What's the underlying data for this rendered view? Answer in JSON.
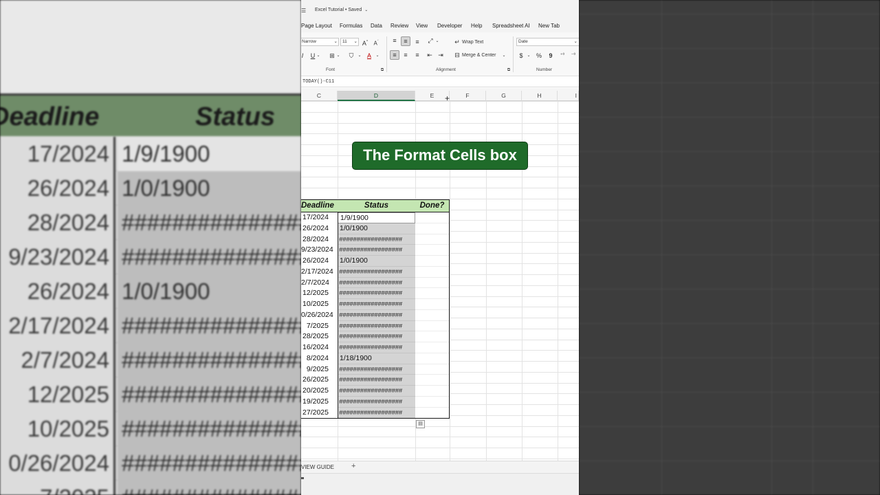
{
  "background_zoom": {
    "header_deadline": "Deadline",
    "header_status": "Status",
    "rows": [
      {
        "deadline": "17/2024",
        "status": "1/9/1900"
      },
      {
        "deadline": "26/2024",
        "status": "1/0/1900"
      },
      {
        "deadline": "28/2024",
        "status": "###################"
      },
      {
        "deadline": "9/23/2024",
        "status": "###################"
      },
      {
        "deadline": "26/2024",
        "status": "1/0/1900"
      },
      {
        "deadline": "2/17/2024",
        "status": "###################"
      },
      {
        "deadline": "2/7/2024",
        "status": "###################"
      },
      {
        "deadline": "12/2025",
        "status": "###################"
      },
      {
        "deadline": "10/2025",
        "status": "###################"
      },
      {
        "deadline": "0/26/2024",
        "status": "###################"
      },
      {
        "deadline": "7/2025",
        "status": "###################"
      }
    ]
  },
  "excel": {
    "title": "Excel Tutorial",
    "saved": "Saved",
    "menu": [
      "Page Layout",
      "Formulas",
      "Data",
      "Review",
      "View",
      "Developer",
      "Help",
      "Spreadsheet AI",
      "New Tab"
    ],
    "ribbon": {
      "font_name": "Narrow",
      "font_size": "11",
      "wrap_text": "Wrap Text",
      "merge_center": "Merge & Center",
      "number_format": "Date",
      "group_font": "Font",
      "group_alignment": "Alignment",
      "group_number": "Number"
    },
    "formula": "TODAY()-C11",
    "columns": [
      "C",
      "D",
      "E",
      "F",
      "G",
      "H",
      "I"
    ],
    "banner": "The Format Cells box",
    "table": {
      "headers": {
        "deadline": "Deadline",
        "status": "Status",
        "done": "Done?"
      },
      "rows": [
        {
          "deadline": "17/2024",
          "status": "1/9/1900",
          "hash": false
        },
        {
          "deadline": "26/2024",
          "status": "1/0/1900",
          "hash": false
        },
        {
          "deadline": "28/2024",
          "status": "##################",
          "hash": true
        },
        {
          "deadline": "9/23/2024",
          "status": "##################",
          "hash": true
        },
        {
          "deadline": "26/2024",
          "status": "1/0/1900",
          "hash": false
        },
        {
          "deadline": "2/17/2024",
          "status": "##################",
          "hash": true
        },
        {
          "deadline": "2/7/2024",
          "status": "##################",
          "hash": true
        },
        {
          "deadline": "12/2025",
          "status": "##################",
          "hash": true
        },
        {
          "deadline": "10/2025",
          "status": "##################",
          "hash": true
        },
        {
          "deadline": "0/26/2024",
          "status": "##################",
          "hash": true
        },
        {
          "deadline": "7/2025",
          "status": "##################",
          "hash": true
        },
        {
          "deadline": "28/2025",
          "status": "##################",
          "hash": true
        },
        {
          "deadline": "16/2024",
          "status": "##################",
          "hash": true
        },
        {
          "deadline": "8/2024",
          "status": "1/18/1900",
          "hash": false
        },
        {
          "deadline": "9/2025",
          "status": "##################",
          "hash": true
        },
        {
          "deadline": "26/2025",
          "status": "##################",
          "hash": true
        },
        {
          "deadline": "20/2025",
          "status": "##################",
          "hash": true
        },
        {
          "deadline": "19/2025",
          "status": "##################",
          "hash": true
        },
        {
          "deadline": "27/2025",
          "status": "##################",
          "hash": true
        }
      ]
    },
    "sheet_tab": "VIEW GUIDE",
    "add_sheet": "+"
  }
}
